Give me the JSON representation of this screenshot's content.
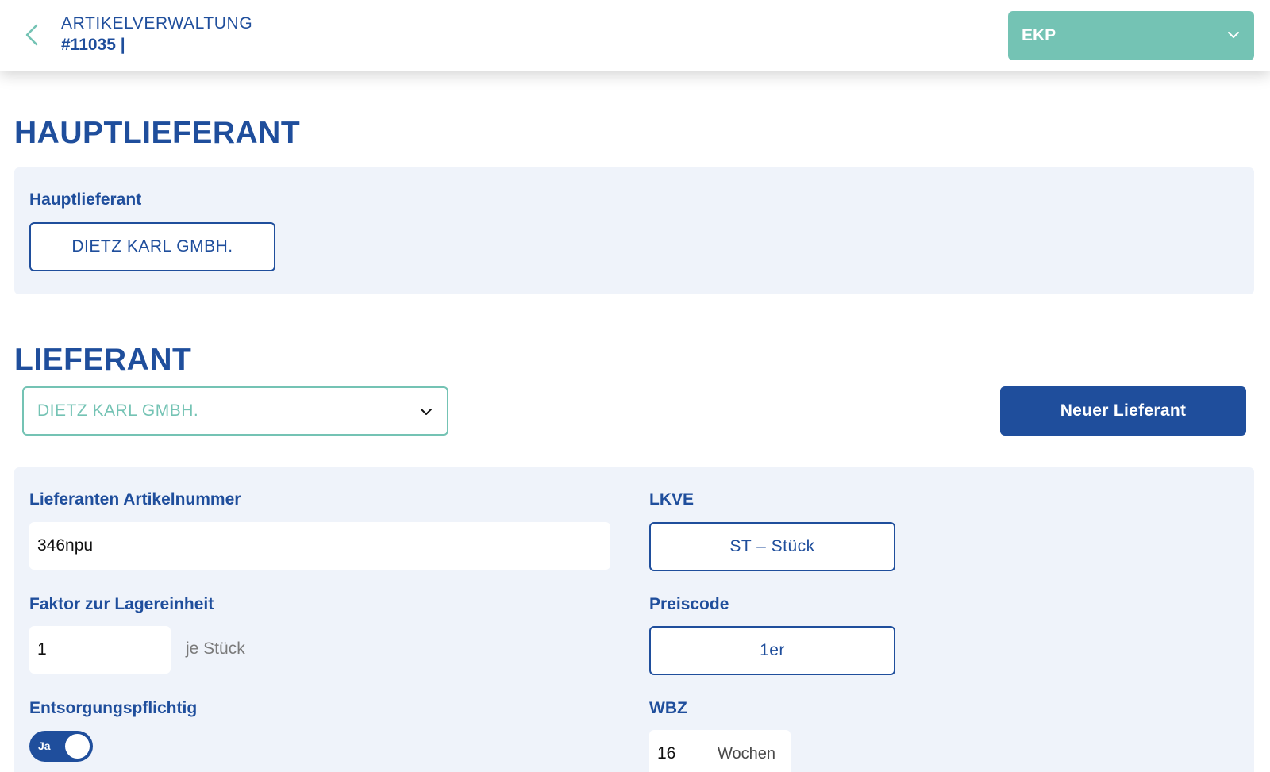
{
  "header": {
    "title": "ARTIKELVERWALTUNG",
    "subtitle": "#11035 |",
    "view_select": "EKP"
  },
  "main_supplier_section": {
    "title": "HAUPTLIEFERANT",
    "field_label": "Hauptlieferant",
    "value": "DIETZ KARL GMBH."
  },
  "supplier_section": {
    "title": "LIEFERANT",
    "selected_supplier": "DIETZ KARL GMBH.",
    "new_supplier_button": "Neuer Lieferant"
  },
  "form": {
    "supplier_article_number": {
      "label": "Lieferanten Artikelnummer",
      "value": "346npu"
    },
    "lkve": {
      "label": "LKVE",
      "value": "ST – Stück"
    },
    "stock_factor": {
      "label": "Faktor zur Lagereinheit",
      "value": "1",
      "unit": "je Stück"
    },
    "price_code": {
      "label": "Preiscode",
      "value": "1er"
    },
    "disposal_required": {
      "label": "Entsorgungspflichtig",
      "toggle_text": "Ja",
      "on": true
    },
    "wbz": {
      "label": "WBZ",
      "value": "16",
      "unit": "Wochen"
    }
  },
  "colors": {
    "primary": "#1f4e9c",
    "accent": "#74c3b4",
    "panel_bg": "#eff3fa"
  }
}
